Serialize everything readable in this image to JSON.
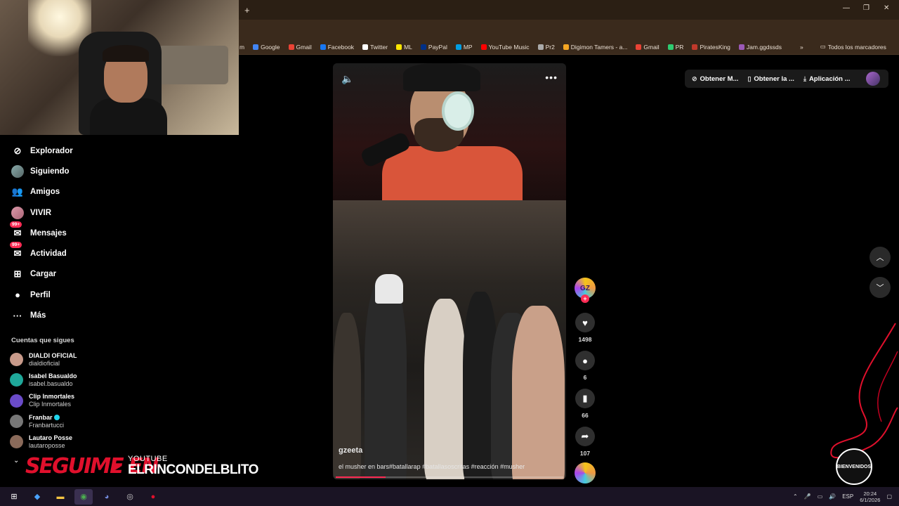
{
  "browser": {
    "new_tab": "+",
    "window_controls": [
      "—",
      "❐",
      "✕"
    ],
    "bookmarks": [
      {
        "label": "m",
        "color": ""
      },
      {
        "label": "Google",
        "color": "#4285f4"
      },
      {
        "label": "Gmail",
        "color": "#ea4335"
      },
      {
        "label": "Facebook",
        "color": "#1877f2"
      },
      {
        "label": "Twitter",
        "color": "#ffffff"
      },
      {
        "label": "ML",
        "color": "#ffe600"
      },
      {
        "label": "PayPal",
        "color": "#003087"
      },
      {
        "label": "MP",
        "color": "#009ee3"
      },
      {
        "label": "YouTube Music",
        "color": "#ff0000"
      },
      {
        "label": "Pr2",
        "color": "#aaaaaa"
      },
      {
        "label": "Digimon Tamers - a...",
        "color": "#f5a623"
      },
      {
        "label": "Gmail",
        "color": "#ea4335"
      },
      {
        "label": "PR",
        "color": "#2ecc71"
      },
      {
        "label": "PiratesKing",
        "color": "#c0392b"
      },
      {
        "label": "Jam.ggdssds",
        "color": "#9b59b6"
      }
    ],
    "bookmarks_more": "»",
    "all_bookmarks": "Todos los marcadores"
  },
  "sidebar": {
    "items": [
      {
        "label": "Explorador",
        "icon": "compass-icon",
        "glyph": "⊘"
      },
      {
        "label": "Siguiendo",
        "icon": "following-avatar-icon",
        "glyph": ""
      },
      {
        "label": "Amigos",
        "icon": "friends-icon",
        "glyph": "👥"
      },
      {
        "label": "VIVIR",
        "icon": "live-icon",
        "glyph": ""
      },
      {
        "label": "Mensajes",
        "icon": "messages-icon",
        "glyph": "✉",
        "badge": "99+"
      },
      {
        "label": "Actividad",
        "icon": "activity-icon",
        "glyph": "✉",
        "badge": "99+"
      },
      {
        "label": "Cargar",
        "icon": "upload-icon",
        "glyph": "⊞"
      },
      {
        "label": "Perfil",
        "icon": "profile-icon",
        "glyph": "●"
      },
      {
        "label": "Más",
        "icon": "more-icon",
        "glyph": "···"
      }
    ],
    "following_title": "Cuentas que sigues",
    "following": [
      {
        "name": "DIALDI OFICIAL",
        "user": "dialdioficial",
        "color": "#c89a8a",
        "verified": false
      },
      {
        "name": "Isabel Basualdo",
        "user": "isabel.basualdo",
        "color": "#1fa89a",
        "verified": false
      },
      {
        "name": "Clip Inmortales",
        "user": "Clip Inmortales",
        "color": "#6a4bc9",
        "verified": false
      },
      {
        "name": "Franbar",
        "user": "Franbartucci",
        "color": "#777777",
        "verified": true
      },
      {
        "name": "Lautaro Posse",
        "user": "lautaroposse",
        "color": "#8a6a5a",
        "verified": false
      }
    ]
  },
  "overlay": {
    "seguime": "SEGUIME EN",
    "yt_label": "YOUTUBE",
    "channel": "ELRINCONDELBLITO"
  },
  "video": {
    "author": "gzeeta",
    "caption": "el musher en bars#batallarap #batallasoscritas #reacción #musher",
    "progress": 0.22
  },
  "actions": {
    "creator_initials": "GZ",
    "likes": "1498",
    "comments": "6",
    "saves": "66",
    "shares": "107"
  },
  "topbar": {
    "items": [
      {
        "label": "Obtener M...",
        "icon": "coin-icon",
        "glyph": "⊘"
      },
      {
        "label": "Obtener la ...",
        "icon": "phone-icon",
        "glyph": "▯"
      },
      {
        "label": "Aplicación ...",
        "icon": "download-icon",
        "glyph": "⤓"
      }
    ]
  },
  "brand_badge": "BIENVENIDOS",
  "taskbar": {
    "apps": [
      {
        "icon": "windows-start-icon",
        "glyph": "⊞",
        "color": "#ffffff"
      },
      {
        "icon": "copilot-icon",
        "glyph": "◆",
        "color": "#4aa3ff"
      },
      {
        "icon": "file-explorer-icon",
        "glyph": "▬",
        "color": "#f5c542"
      },
      {
        "icon": "chrome-icon",
        "glyph": "◉",
        "color": "#4caf50"
      },
      {
        "icon": "discord-icon",
        "glyph": "◕",
        "color": "#7289da"
      },
      {
        "icon": "obs-icon",
        "glyph": "◎",
        "color": "#cccccc"
      },
      {
        "icon": "record-app-icon",
        "glyph": "●",
        "color": "#e0102c"
      }
    ],
    "lang": "ESP",
    "time": "20:24",
    "date": "6/1/2026"
  }
}
